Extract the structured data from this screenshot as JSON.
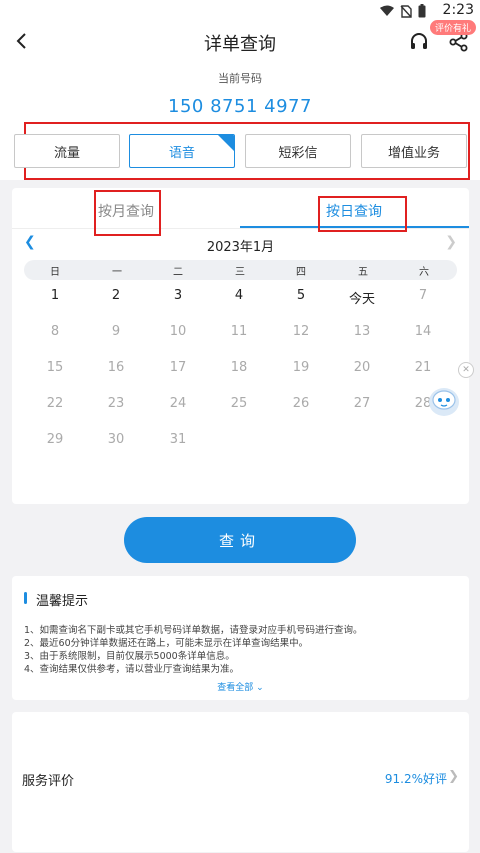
{
  "status_bar": {
    "time": "2:23",
    "badge": "评价有礼"
  },
  "header": {
    "title": "详单查询"
  },
  "number": {
    "label": "当前号码",
    "value": "150 8751 4977"
  },
  "categories": [
    {
      "label": "流量",
      "active": false
    },
    {
      "label": "语音",
      "active": true
    },
    {
      "label": "短彩信",
      "active": false
    },
    {
      "label": "增值业务",
      "active": false
    }
  ],
  "mode_tabs": [
    {
      "label": "按月查询",
      "active": false
    },
    {
      "label": "按日查询",
      "active": true
    }
  ],
  "calendar": {
    "month_title": "2023年1月",
    "weekdays": [
      "日",
      "一",
      "二",
      "三",
      "四",
      "五",
      "六"
    ],
    "rows": [
      [
        "1",
        "2",
        "3",
        "4",
        "5",
        "今天",
        "7"
      ],
      [
        "8",
        "9",
        "10",
        "11",
        "12",
        "13",
        "14"
      ],
      [
        "15",
        "16",
        "17",
        "18",
        "19",
        "20",
        "21"
      ],
      [
        "22",
        "23",
        "24",
        "25",
        "26",
        "27",
        "28"
      ],
      [
        "29",
        "30",
        "31",
        "",
        "",
        "",
        ""
      ]
    ],
    "current_days": [
      "1",
      "2",
      "3",
      "4",
      "5",
      "今天"
    ]
  },
  "query_button": "查询",
  "tips": {
    "title": "温馨提示",
    "items": [
      "1、如需查询名下副卡或其它手机号码详单数据，请登录对应手机号码进行查询。",
      "2、最近60分钟详单数据还在路上，可能未显示在详单查询结果中。",
      "3、由于系统限制，目前仅展示5000条详单信息。",
      "4、查询结果仅供参考，请以营业厅查询结果为准。"
    ],
    "more": "查看全部"
  },
  "rating": {
    "label": "服务评价",
    "value": "91.2%好评"
  },
  "colors": {
    "accent": "#1d8de0",
    "annotation_red": "#e02020"
  }
}
